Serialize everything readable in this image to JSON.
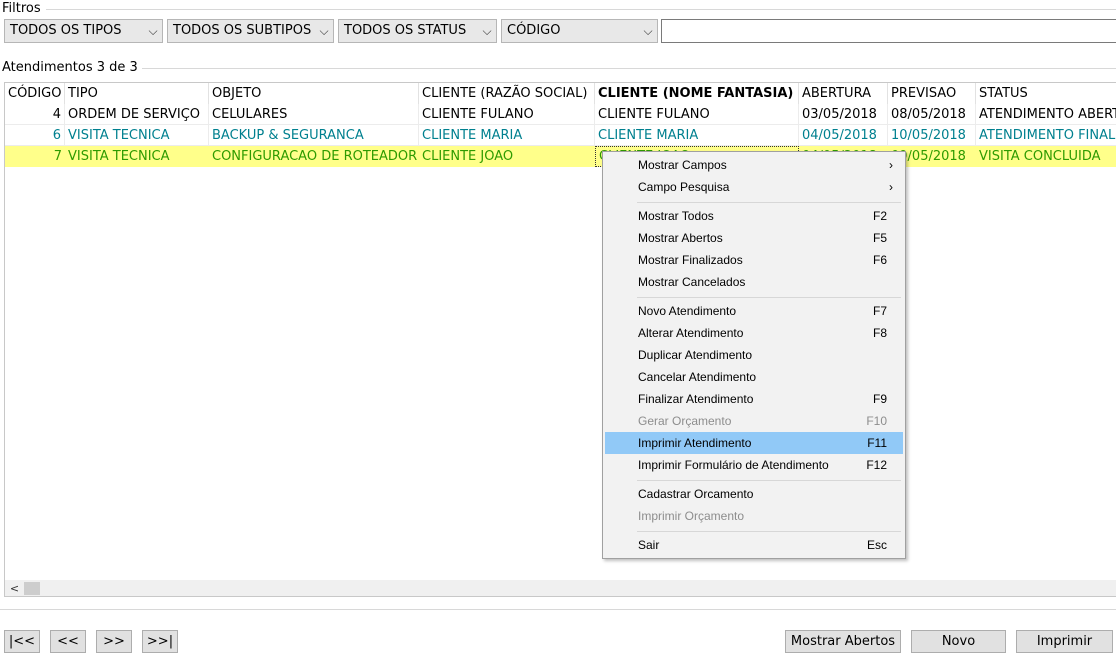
{
  "filters": {
    "label": "Filtros",
    "tipo": "TODOS OS TIPOS",
    "subtipo": "TODOS OS SUBTIPOS",
    "status": "TODOS OS STATUS",
    "campo": "CÓDIGO",
    "search_value": ""
  },
  "list": {
    "count_label": "Atendimentos 3 de 3"
  },
  "columns": [
    "CÓDIGO",
    "TIPO",
    "OBJETO",
    "CLIENTE (RAZÃO SOCIAL)",
    "CLIENTE (NOME FANTASIA)",
    "ABERTURA",
    "PREVISAO",
    "STATUS"
  ],
  "rows": [
    [
      "4",
      "ORDEM DE SERVIÇO",
      "CELULARES",
      "CLIENTE FULANO",
      "CLIENTE FULANO",
      "03/05/2018",
      "08/05/2018",
      "ATENDIMENTO ABERTO"
    ],
    [
      "6",
      "VISITA TECNICA",
      "BACKUP & SEGURANCA",
      "CLIENTE MARIA",
      "CLIENTE MARIA",
      "04/05/2018",
      "10/05/2018",
      "ATENDIMENTO FINALIZADO"
    ],
    [
      "7",
      "VISITA TECNICA",
      "CONFIGURACAO DE ROTEADOR",
      "CLIENTE JOAO",
      "CLIENTE JOAO",
      "04/05/2018",
      "09/05/2018",
      "VISITA CONCLUIDA"
    ]
  ],
  "row_colors": {
    "row0": "#000000",
    "row1": "#00808f",
    "row2": "#2e9b00",
    "selected_bg": "#ffff8a"
  },
  "context_menu": {
    "mostrar_campos": "Mostrar Campos",
    "campo_pesquisa": "Campo Pesquisa",
    "mostrar_todos": "Mostrar Todos",
    "mostrar_todos_key": "F2",
    "mostrar_abertos": "Mostrar Abertos",
    "mostrar_abertos_key": "F5",
    "mostrar_finalizados": "Mostrar Finalizados",
    "mostrar_finalizados_key": "F6",
    "mostrar_cancelados": "Mostrar Cancelados",
    "novo": "Novo Atendimento",
    "novo_key": "F7",
    "alterar": "Alterar Atendimento",
    "alterar_key": "F8",
    "duplicar": "Duplicar Atendimento",
    "cancelar": "Cancelar Atendimento",
    "finalizar": "Finalizar Atendimento",
    "finalizar_key": "F9",
    "gerar_orcamento": "Gerar Orçamento",
    "gerar_orcamento_key": "F10",
    "imprimir": "Imprimir Atendimento",
    "imprimir_key": "F11",
    "imprimir_formulario": "Imprimir Formulário de Atendimento",
    "imprimir_formulario_key": "F12",
    "cadastrar_orcamento": "Cadastrar Orcamento",
    "imprimir_orcamento": "Imprimir Orçamento",
    "sair": "Sair",
    "sair_key": "Esc",
    "highlight_color": "#91c9f7"
  },
  "pager": {
    "first": "|<<",
    "prev": "<<",
    "next": ">>",
    "last": ">>|"
  },
  "actions": {
    "mostrar_abertos": "Mostrar Abertos",
    "novo": "Novo",
    "imprimir": "Imprimir"
  },
  "icons": {
    "dropdown": "chevron-down-icon",
    "submenu": "chevron-right-icon",
    "scroll_left": "arrow-left-icon"
  }
}
